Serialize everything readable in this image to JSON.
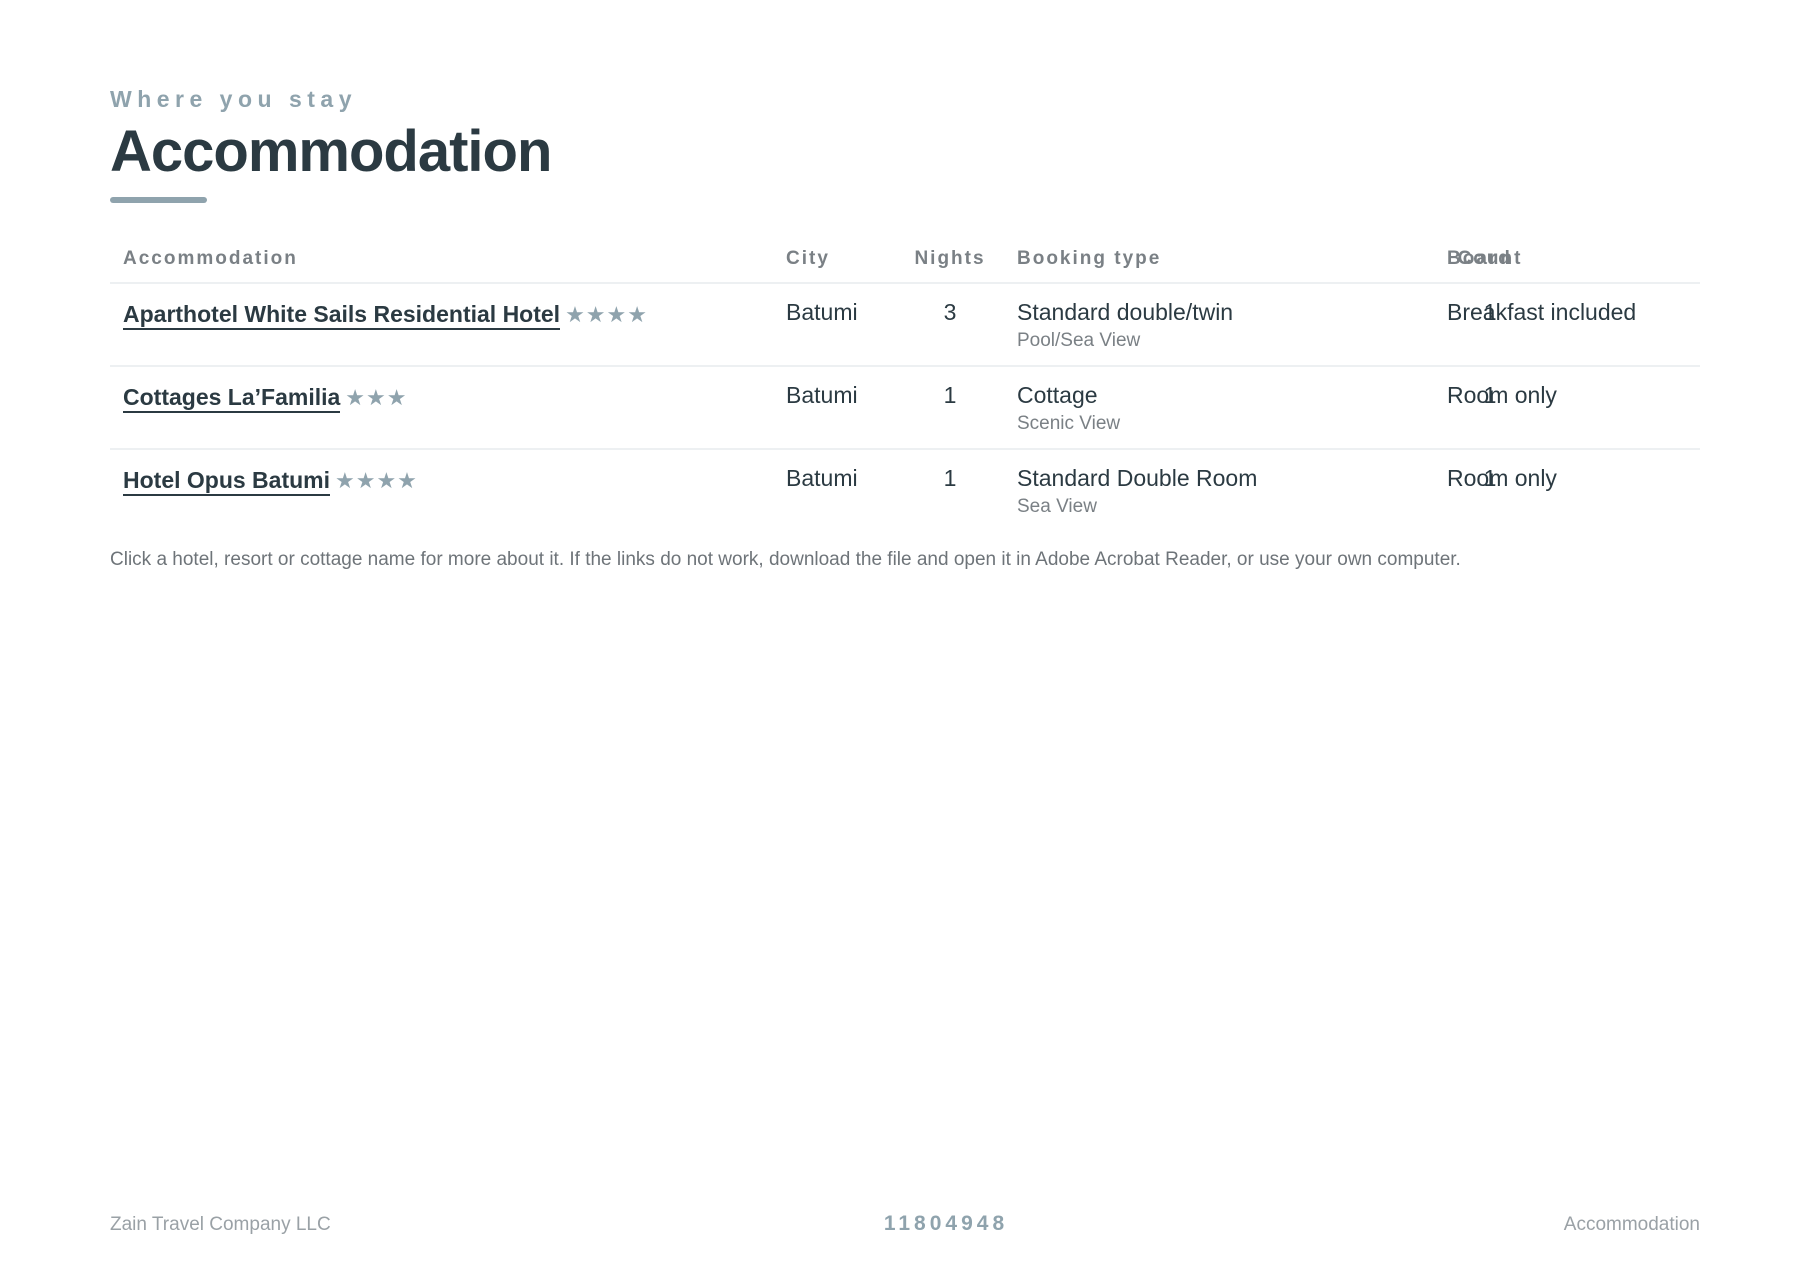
{
  "header": {
    "eyebrow": "Where you stay",
    "title": "Accommodation"
  },
  "table": {
    "columns": {
      "accommodation": "Accommodation",
      "city": "City",
      "nights": "Nights",
      "booking_type": "Booking type",
      "count": "Count",
      "board": "Board"
    },
    "rows": [
      {
        "name": "Aparthotel White Sails Residential Hotel",
        "stars": "★★★★",
        "star_rating": 4,
        "city": "Batumi",
        "nights": "3",
        "booking_type": "Standard double/twin",
        "booking_sub": "Pool/Sea View",
        "count": "1",
        "board": "Breakfast included"
      },
      {
        "name": "Cottages La’Familia",
        "stars": "★★★",
        "star_rating": 3,
        "city": "Batumi",
        "nights": "1",
        "booking_type": "Cottage",
        "booking_sub": "Scenic View",
        "count": "1",
        "board": "Room only"
      },
      {
        "name": "Hotel Opus Batumi",
        "stars": "★★★★",
        "star_rating": 4,
        "city": "Batumi",
        "nights": "1",
        "booking_type": "Standard Double Room",
        "booking_sub": "Sea View",
        "count": "1",
        "board": "Room only"
      }
    ]
  },
  "note": "Click a hotel, resort or cottage name for more about it. If the links do not work, download the file and open it in Adobe Acrobat Reader, or use your own computer.",
  "footer": {
    "company": "Zain Travel Company LLC",
    "reference": "11804948",
    "section": "Accommodation"
  },
  "colors": {
    "text": "#2b3a42",
    "accent": "#8fa3ad",
    "muted": "#7a8085",
    "divider": "#edf0f2"
  }
}
